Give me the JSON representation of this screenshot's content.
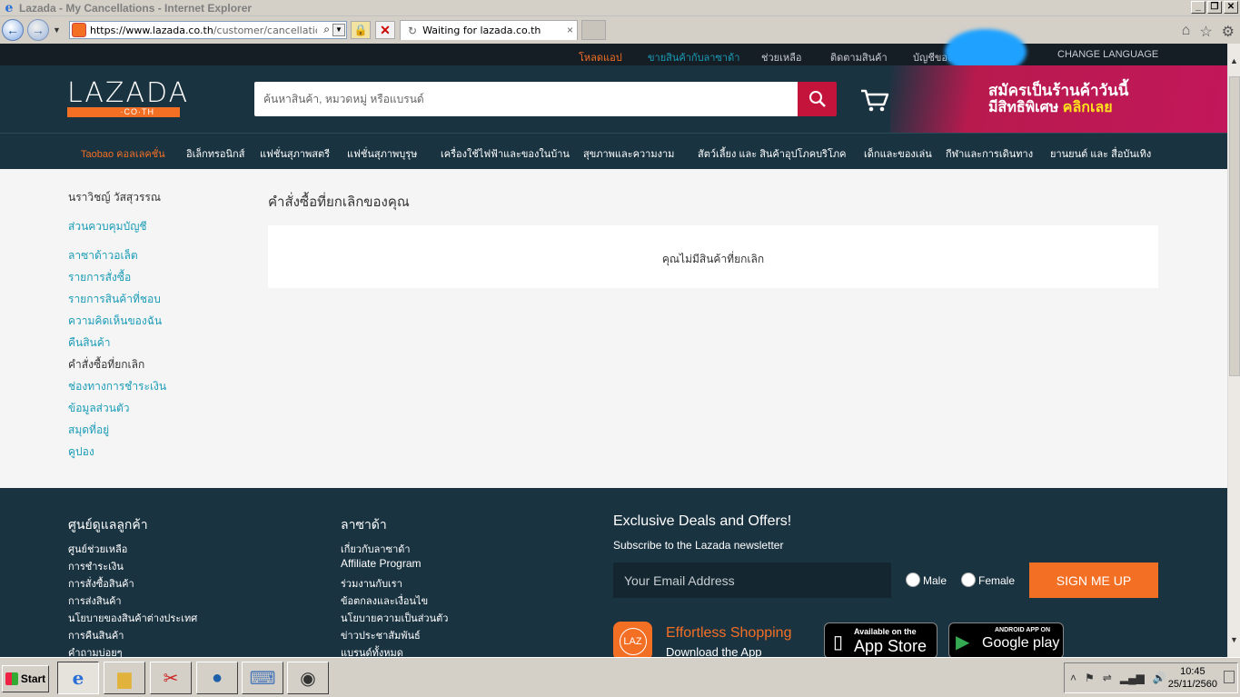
{
  "window": {
    "title": "Lazada - My Cancellations - Internet Explorer",
    "controls": [
      "_",
      "❐",
      "✕"
    ]
  },
  "browser": {
    "url_host": "https://www.lazada.co.th",
    "url_path": "/customer/cancellations/ir",
    "tab_label": "Waiting for lazada.co.th"
  },
  "topbar": {
    "links": [
      {
        "label": "โหลดแอป",
        "color": "#f36f24"
      },
      {
        "label": "ขายสินค้ากับลาซาด้า",
        "color": "#c7ccd1"
      },
      {
        "label": "ช่วยเหลือ",
        "color": "#c7ccd1"
      },
      {
        "label": "ติดตามสินค้า",
        "color": "#c7ccd1"
      },
      {
        "label": "บัญชีของ",
        "color": "#c7ccd1"
      },
      {
        "label": "CHANGE LANGUAGE",
        "color": "#c7ccd1"
      }
    ]
  },
  "header": {
    "logo_word": "LAZADA",
    "logo_sub": "·CO·TH",
    "search_placeholder": "ค้นหาสินค้า, หมวดหมู่ หรือแบรนด์",
    "promo_line1": "สมัครเป็นร้านค้าวันนี้",
    "promo_line2": "มีสิทธิพิเศษ",
    "promo_highlight": "คลิกเลย"
  },
  "categories": [
    "Taobao คอลเลคชั่น",
    "อิเล็กทรอนิกส์",
    "แฟชั่นสุภาพสตรี",
    "แฟชั่นสุภาพบุรุษ",
    "เครื่องใช้ไฟฟ้าและของในบ้าน",
    "สุขภาพและความงาม",
    "สัตว์เลี้ยง และ สินค้าอุปโภคบริโภค",
    "เด็กและของเล่น",
    "กีฬาและการเดินทาง",
    "ยานยนต์ และ สื่อบันเทิง"
  ],
  "account": {
    "user_name": "นราวิชญ์ วัสสุวรรณ",
    "menu": [
      "ส่วนควบคุมบัญชี",
      "ลาซาด้าวอเล็ต",
      "รายการสั่งซื้อ",
      "รายการสินค้าที่ชอบ",
      "ความคิดเห็นของฉัน",
      "คืนสินค้า",
      "คำสั่งซื้อที่ยกเลิก",
      "ช่องทางการชำระเงิน",
      "ข้อมูลส่วนตัว",
      "สมุดที่อยู่",
      "คูปอง"
    ],
    "current_index": 6
  },
  "main": {
    "page_title": "คำสั่งซื้อที่ยกเลิกของคุณ",
    "empty_message": "คุณไม่มีสินค้าที่ยกเลิก"
  },
  "footer": {
    "col1": {
      "heading": "ศูนย์ดูแลลูกค้า",
      "links": [
        "ศูนย์ช่วยเหลือ",
        "การชำระเงิน",
        "การสั่งซื้อสินค้า",
        "การส่งสินค้า",
        "นโยบายของสินค้าต่างประเทศ",
        "การคืนสินค้า",
        "คำถามบ่อยๆ"
      ]
    },
    "col2": {
      "heading": "ลาซาด้า",
      "links": [
        "เกี่ยวกับลาซาด้า",
        "Affiliate Program",
        "ร่วมงานกับเรา",
        "ข้อตกลงและเงื่อนไข",
        "นโยบายความเป็นส่วนตัว",
        "ข่าวประชาสัมพันธ์",
        "แบรนด์ทั้งหมด"
      ]
    },
    "newsletter": {
      "heading": "Exclusive Deals and Offers!",
      "subtitle": "Subscribe to the Lazada newsletter",
      "email_placeholder": "Your Email Address",
      "male": "Male",
      "female": "Female",
      "signup": "SIGN ME UP"
    },
    "app": {
      "icon_text": "LAZ",
      "title": "Effortless Shopping",
      "subtitle": "Download the App",
      "appstore_small": "Available on the",
      "appstore_big": "App Store",
      "google_small": "ANDROID APP ON",
      "google_big": "Google play"
    }
  },
  "taskbar": {
    "start": "Start",
    "time": "10:45",
    "date": "25/11/2560"
  },
  "colors": {
    "brand_orange": "#f36f24",
    "brand_navy": "#1a3341",
    "link_teal": "#1a9cb7",
    "search_red": "#c4143c"
  }
}
